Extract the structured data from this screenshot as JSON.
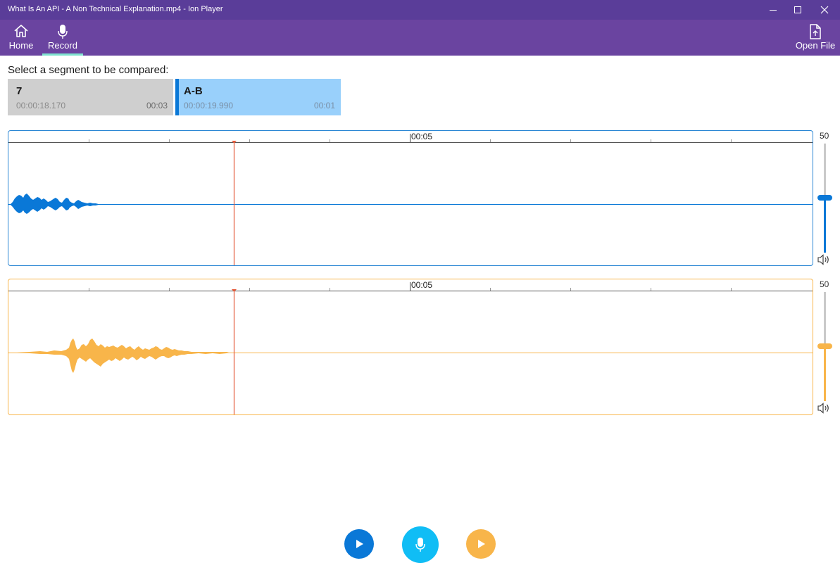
{
  "window": {
    "title": "What Is An API - A Non Technical Explanation.mp4 - Ion Player",
    "controls": [
      "minimize-icon",
      "maximize-icon",
      "close-icon"
    ]
  },
  "nav": {
    "home_label": "Home",
    "record_label": "Record",
    "open_file_label": "Open File",
    "active": "Record"
  },
  "compare": {
    "prompt": "Select a segment to be compared:",
    "segments": [
      {
        "name": "7",
        "time": "00:00:18.170",
        "duration": "00:03",
        "selected": false
      },
      {
        "name": "A-B",
        "time": "00:00:19.990",
        "duration": "00:01",
        "selected": true
      }
    ]
  },
  "tracks": {
    "original": {
      "time_label": "00:05",
      "volume": "50",
      "color": "#0a78d7"
    },
    "recording": {
      "time_label": "00:05",
      "volume": "50",
      "color": "#f8b54a"
    }
  },
  "controls": {
    "play_original": "play-icon",
    "record": "microphone-icon",
    "play_recording": "play-icon"
  },
  "colors": {
    "titlebar": "#5a3d99",
    "navbar": "#6a44a0",
    "accent_blue": "#0a78d7",
    "accent_cyan": "#10bdf5",
    "accent_orange": "#f8b54a",
    "playhead": "#e55a3a",
    "tab_underline": "#7fe3cf"
  }
}
